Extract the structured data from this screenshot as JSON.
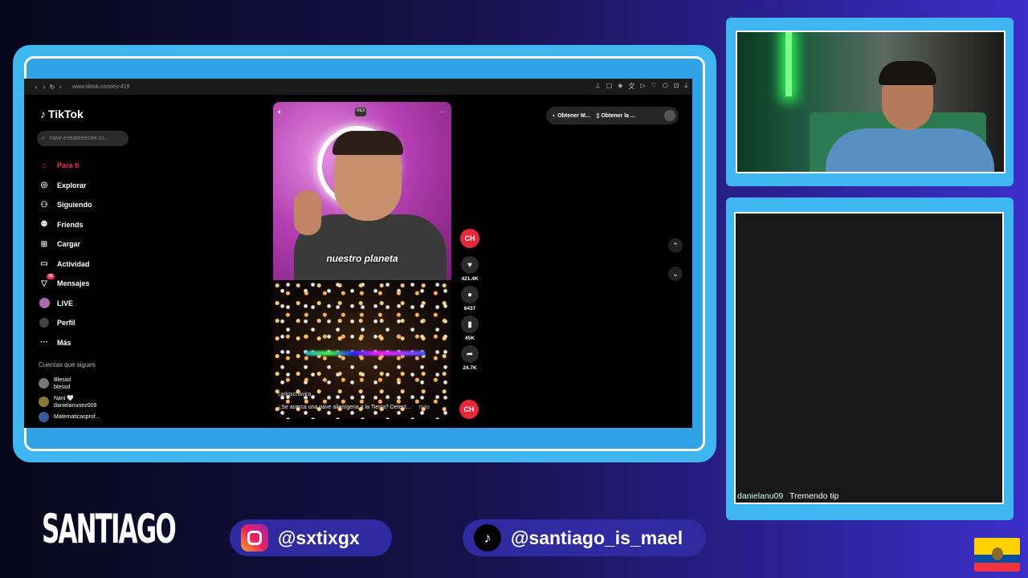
{
  "browser": {
    "url": "www.tiktok.com/es-419"
  },
  "tiktok": {
    "logo": "TikTok",
    "search_placeholder": "nave extraterrestre co...",
    "nav": [
      {
        "label": "Para ti",
        "icon": "home-icon"
      },
      {
        "label": "Explorar",
        "icon": "compass-icon"
      },
      {
        "label": "Siguiendo",
        "icon": "following-icon"
      },
      {
        "label": "Friends",
        "icon": "friends-icon"
      },
      {
        "label": "Cargar",
        "icon": "upload-icon"
      },
      {
        "label": "Actividad",
        "icon": "activity-icon"
      },
      {
        "label": "Mensajes",
        "icon": "messages-icon",
        "badge": "41"
      },
      {
        "label": "LIVE",
        "icon": "live-icon"
      },
      {
        "label": "Perfil",
        "icon": "profile-icon"
      },
      {
        "label": "Más",
        "icon": "more-icon"
      }
    ],
    "following_title": "Cuentas que sigues",
    "following": [
      {
        "name": "Blessd",
        "handle": "blessd"
      },
      {
        "name": "Nani 🤍",
        "handle": "danielanunez009"
      },
      {
        "name": "Matematicasprof...",
        "handle": ""
      }
    ],
    "video": {
      "rex": "REX",
      "caption": "nuestro planeta",
      "author": "carloschavira",
      "description": "¿Se acerca una nave alienígena a la Tierra? Detect...",
      "more": "más"
    },
    "actions": {
      "channel_logo": "CH",
      "likes": "421.4K",
      "comments": "6437",
      "saves": "45K",
      "shares": "24.7K"
    },
    "obtain": [
      "Obtener M...",
      "Obtener la ..."
    ]
  },
  "chat": {
    "user": "danielanu09",
    "message": "Tremendo tip"
  },
  "overlay": {
    "name": "SANTIAGO",
    "instagram": "@sxtixgx",
    "tiktok": "@santiago_is_mael"
  },
  "colors": {
    "frame": "#3fb6f0",
    "accent": "#fe2c55",
    "pill": "#2e2a9f"
  }
}
